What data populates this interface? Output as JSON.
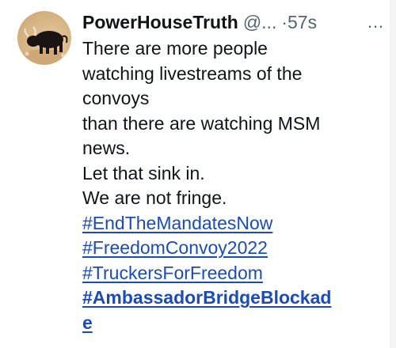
{
  "tweet": {
    "author": {
      "name": "PowerHouseTruth",
      "handle": "@...",
      "avatar_icon": "bull-avatar-icon"
    },
    "timestamp": "·57s",
    "more_icon": "…",
    "lines": [
      "There are more people",
      "watching livestreams of the",
      "convoys",
      "than there are watching MSM",
      "news.",
      "Let that sink in.",
      "We are not fringe."
    ],
    "hashtags": [
      "#EndTheMandatesNow",
      "#FreedomConvoy2022",
      "#TruckersForFreedom"
    ],
    "last_hashtag_part1": "#AmbassadorBridgeBlockad",
    "last_hashtag_part2": "e"
  },
  "colors": {
    "link": "#1a4bb8",
    "muted": "#536471",
    "text": "#0f1419"
  }
}
